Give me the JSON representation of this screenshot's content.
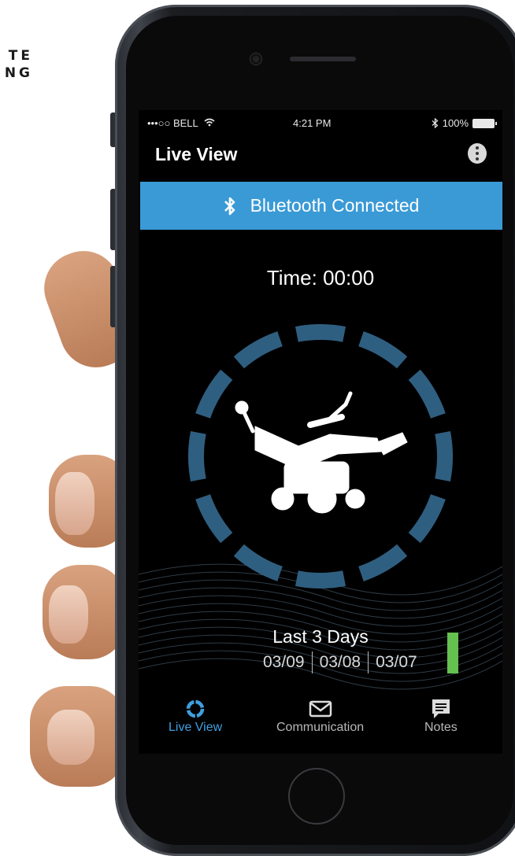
{
  "brand": {
    "line1": "TE",
    "line2": "NG"
  },
  "status_bar": {
    "carrier": "•••○○ BELL",
    "time": "4:21 PM",
    "battery": "100%",
    "icons": [
      "wifi-icon",
      "bluetooth-icon",
      "battery-icon"
    ]
  },
  "app_bar": {
    "title": "Live View",
    "menu_icon": "kebab-menu-icon"
  },
  "banner": {
    "label": "Bluetooth Connected",
    "icon": "bluetooth-icon",
    "color": "#3a9ad6"
  },
  "timer": {
    "label": "Time: 00:00"
  },
  "gauge": {
    "segments": 12,
    "icon": "power-wheelchair-icon",
    "color": "#2f5f80"
  },
  "history": {
    "title": "Last 3 Days",
    "dates": [
      "03/09",
      "03/08",
      "03/07"
    ],
    "indicator_color": "#65c14f"
  },
  "tabs": [
    {
      "label": "Live View",
      "icon": "ring-icon",
      "active": true
    },
    {
      "label": "Communication",
      "icon": "envelope-icon",
      "active": false
    },
    {
      "label": "Notes",
      "icon": "notes-icon",
      "active": false
    }
  ],
  "accent_color": "#3f9fe0"
}
